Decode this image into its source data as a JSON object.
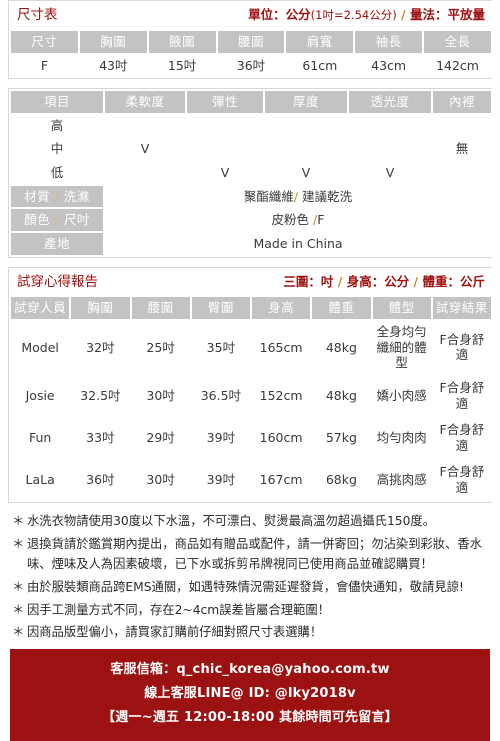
{
  "size_table": {
    "title": "尺寸表",
    "unit_note_main": "單位：公分",
    "unit_note_paren": "(1吋=2.54公分)",
    "unit_note_sep": " / ",
    "unit_note_tail": "量法：平放量",
    "headers": [
      "尺寸",
      "胸圍",
      "腋圍",
      "腰圍",
      "肩寬",
      "袖長",
      "全長"
    ],
    "rows": [
      [
        "F",
        "43吋",
        "15吋",
        "36吋",
        "61cm",
        "43cm",
        "142cm"
      ]
    ]
  },
  "fabric_table": {
    "headers": [
      "項目",
      "柔軟度",
      "彈性",
      "厚度",
      "透光度",
      "內裡"
    ],
    "levels": [
      "高",
      "中",
      "低"
    ],
    "marks": {
      "high": [
        "",
        "",
        "",
        ""
      ],
      "mid": [
        "V",
        "",
        "",
        ""
      ],
      "low": [
        "",
        "V",
        "V",
        "V"
      ]
    },
    "lining_value": "無",
    "info_rows": [
      {
        "label_a": "材質",
        "label_sep": " / ",
        "label_b": "洗滌",
        "value_a": "聚酯纖維",
        "value_sep": "/ ",
        "value_b": "建議乾洗"
      },
      {
        "label_a": "顏色",
        "label_sep": " / ",
        "label_b": "尺吋",
        "value_a": "皮粉色 ",
        "value_sep": "/",
        "value_b": "F"
      },
      {
        "label_a": "產地",
        "label_sep": "",
        "label_b": "",
        "value_a": "Made in China",
        "value_sep": "",
        "value_b": ""
      }
    ]
  },
  "tryon_table": {
    "title": "試穿心得報告",
    "unit_note_a": "三圍：吋",
    "unit_note_sep1": " / ",
    "unit_note_b": "身高：公分",
    "unit_note_sep2": " / ",
    "unit_note_c": "體重：公斤",
    "headers": [
      "試穿人員",
      "胸圍",
      "腰圍",
      "臀圍",
      "身高",
      "體重",
      "體型",
      "試穿結果"
    ],
    "rows": [
      [
        "Model",
        "32吋",
        "25吋",
        "35吋",
        "165cm",
        "48kg",
        "全身均勻纖細的體型",
        "F合身舒適"
      ],
      [
        "Josie",
        "32.5吋",
        "30吋",
        "36.5吋",
        "152cm",
        "48kg",
        "嬌小肉感",
        "F合身舒適"
      ],
      [
        "Fun",
        "33吋",
        "29吋",
        "39吋",
        "160cm",
        "57kg",
        "均勻肉肉",
        "F合身舒適"
      ],
      [
        "LaLa",
        "36吋",
        "30吋",
        "39吋",
        "167cm",
        "68kg",
        "高挑肉感",
        "F合身舒適"
      ]
    ]
  },
  "notes": {
    "star": "＊",
    "items": [
      "水洗衣物請使用30度以下水溫，不可漂白、熨燙最高溫勿超過攝氏150度。",
      "退換貨請於鑑賞期內提出，商品如有贈品或配件，請一併寄回；勿沾染到彩妝、香水味、煙味及人為因素破壞，已下水或拆剪吊牌視同已使用商品並確認購買！",
      "由於服裝類商品跨EMS通關，如遇特殊情況需延遲發貨，會儘快通知，敬請見諒!",
      "因手工測量方式不同，存在2~4cm誤差皆屬合理範圍！",
      "因商品版型偏小，請買家訂購前仔細對照尺寸表選購！"
    ]
  },
  "contact": {
    "email_line": "客服信箱：q_chic_korea@yahoo.com.tw",
    "line_line": "線上客服LINE@ ID: @lky2018v",
    "hours_line": "【週一~週五 12:00-18:00 其餘時間可先留言】",
    "bg_color": "#9c1111"
  },
  "colors": {
    "header_gray": "#c3c3c3",
    "title_red": "#a01010",
    "accent_sep": "#c88a2a"
  }
}
